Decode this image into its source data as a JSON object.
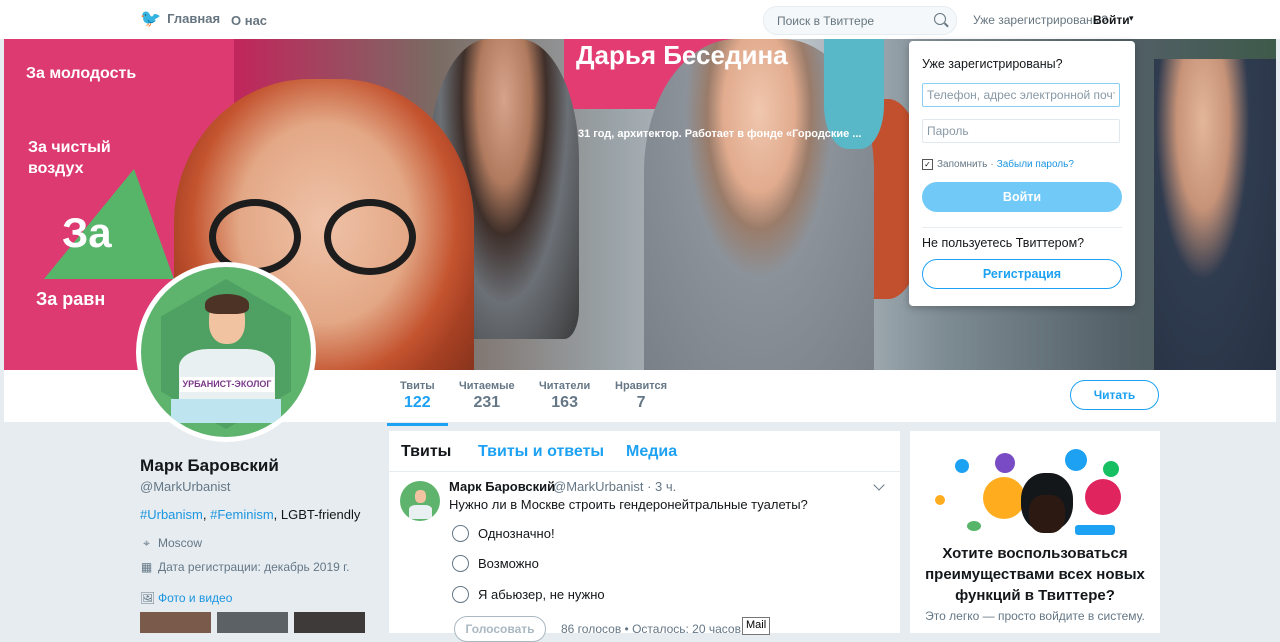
{
  "topbar": {
    "home_label": "Главная",
    "about_label": "О нас",
    "search_placeholder": "Поиск в Твиттере",
    "already_registered": "Уже зарегистрированы?",
    "login_label": "Войти",
    "caret": "▾"
  },
  "banner": {
    "text_1": "За молодость",
    "text_2": "За чистый воздух",
    "text_3": "За",
    "text_4": "За равн",
    "text_5": "Дарья Беседина",
    "text_6": "31 год, архитектор. Работает в фонде «Городские ..."
  },
  "avatar": {
    "label": "УРБАНИСТ-ЭКОЛОГ"
  },
  "stats": [
    {
      "label": "Твиты",
      "value": "122"
    },
    {
      "label": "Читаемые",
      "value": "231"
    },
    {
      "label": "Читатели",
      "value": "163"
    },
    {
      "label": "Нравится",
      "value": "7"
    }
  ],
  "follow_label": "Читать",
  "profile": {
    "name": "Марк Баровский",
    "handle": "@MarkUrbanist",
    "bio_tag1": "#Urbanism",
    "bio_sep": ", ",
    "bio_tag2": "#Feminism",
    "bio_rest": ", LGBT-friendly",
    "location": "Moscow",
    "joined": "Дата регистрации: декабрь 2019 г.",
    "media_link": "Фото и видео"
  },
  "timeline": {
    "tabs": [
      "Твиты",
      "Твиты и ответы",
      "Медиа"
    ],
    "tweet": {
      "name": "Марк Баровский",
      "meta": "@MarkUrbanist · 3 ч.",
      "text": "Нужно ли в Москве строить гендеронейтральные туалеты?",
      "options": [
        "Однозначно!",
        "Возможно",
        "Я абьюзер, не нужно"
      ],
      "vote_label": "Голосовать",
      "poll_meta": "86 голосов • Осталось: 20 часов"
    }
  },
  "tooltip": "Mail",
  "promo": {
    "title": "Хотите воспользоваться преимуществами всех новых функций в Твиттере?",
    "subtitle": "Это легко — просто войдите в систему."
  },
  "login_card": {
    "title": "Уже зарегистрированы?",
    "phone_placeholder": "Телефон, адрес электронной почты или имя пользователя",
    "password_placeholder": "Пароль",
    "remember": "Запомнить",
    "separator": "·",
    "forgot": "Забыли пароль?",
    "login_button": "Войти",
    "new_user": "Не пользуетесь Твиттером?",
    "signup_button": "Регистрация"
  }
}
